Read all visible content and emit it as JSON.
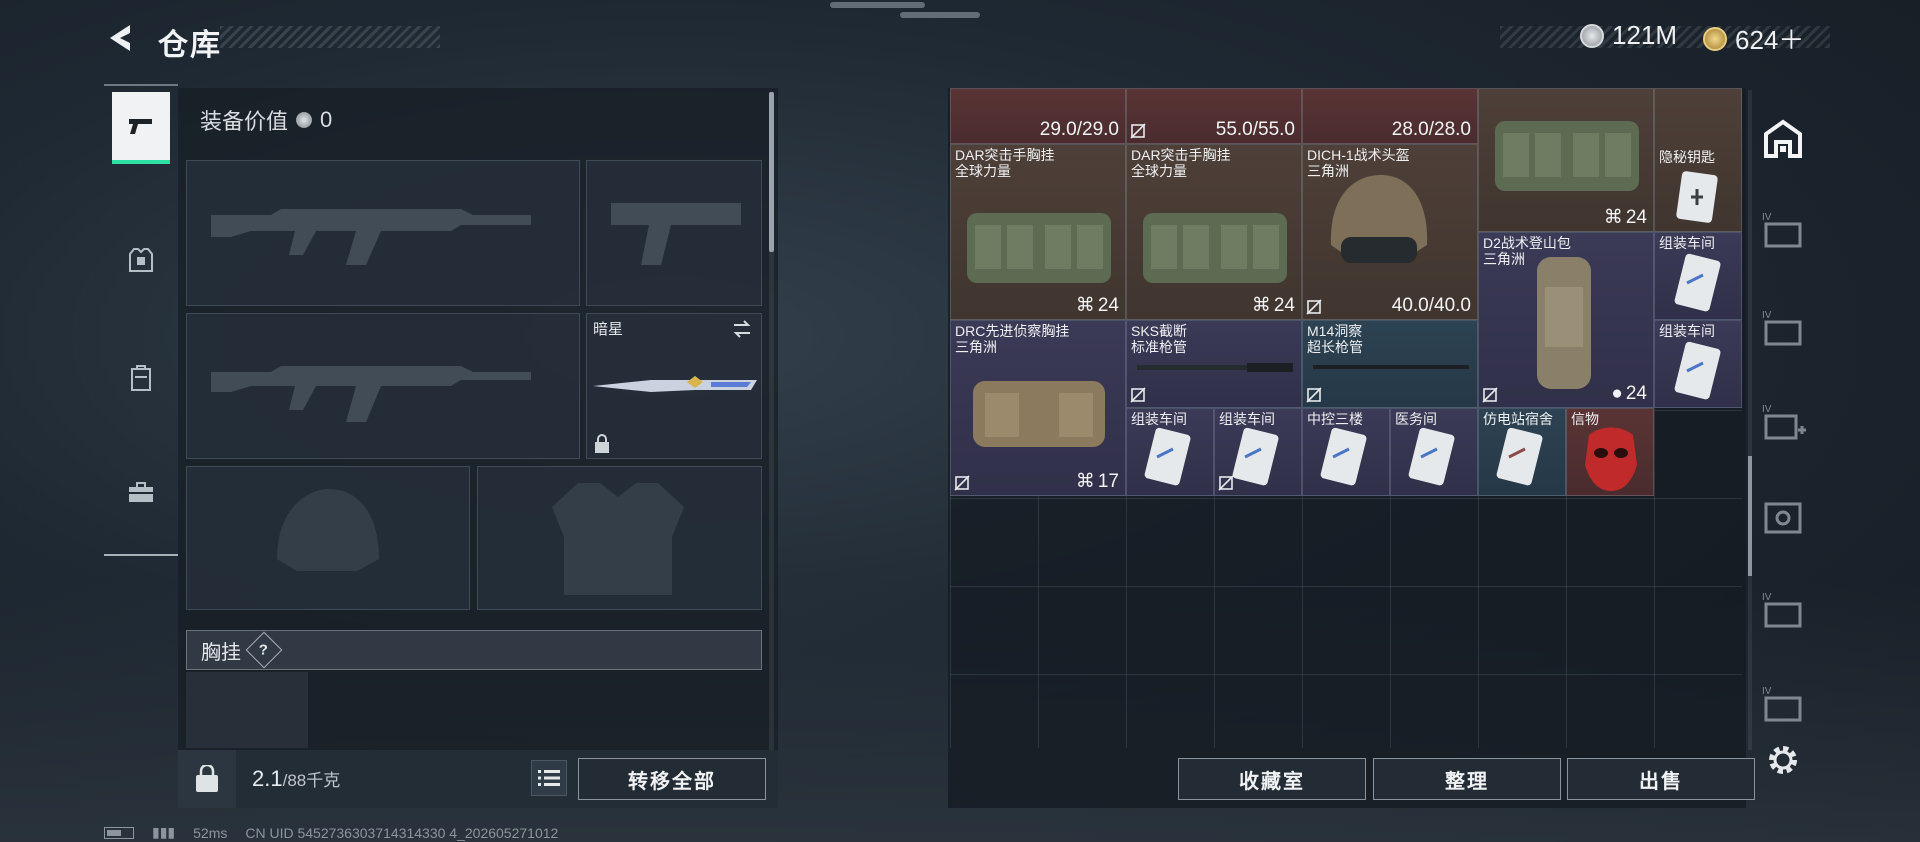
{
  "header": {
    "title": "仓库",
    "currencies": [
      {
        "icon": "silver-coin-icon",
        "amount": "121M"
      },
      {
        "icon": "gold-coin-icon",
        "amount": "624＋"
      }
    ]
  },
  "equipment": {
    "value_label": "装备价值",
    "value": "0",
    "knife_slot": {
      "skin_name": "暗星"
    },
    "chest_rig_section": {
      "label": "胸挂",
      "help": "?"
    },
    "weight_current": "2.1",
    "weight_max": "/88千克",
    "transfer_all": "转移全部"
  },
  "stash": {
    "items": [
      {
        "name": "",
        "sub": "",
        "durability": "29.0/29.0",
        "qty": ""
      },
      {
        "name": "",
        "sub": "",
        "durability": "55.0/55.0",
        "qty": ""
      },
      {
        "name": "",
        "sub": "",
        "durability": "28.0/28.0",
        "qty": ""
      },
      {
        "name": "",
        "sub": "",
        "durability": "",
        "qty": "24"
      },
      {
        "name": "隐秘钥匙",
        "sub": "",
        "durability": "",
        "qty": ""
      },
      {
        "name": "DAR突击手胸挂",
        "sub": "全球力量",
        "durability": "",
        "qty": "24"
      },
      {
        "name": "DAR突击手胸挂",
        "sub": "全球力量",
        "durability": "",
        "qty": "24"
      },
      {
        "name": "DICH-1战术头盔",
        "sub": "三角洲",
        "durability": "40.0/40.0",
        "qty": ""
      },
      {
        "name": "D2战术登山包",
        "sub": "三角洲",
        "durability": "",
        "qty": "24"
      },
      {
        "name": "组装车间",
        "sub": "",
        "durability": "",
        "qty": ""
      },
      {
        "name": "组装车间",
        "sub": "",
        "durability": "",
        "qty": ""
      },
      {
        "name": "DRC先进侦察胸挂",
        "sub": "三角洲",
        "durability": "",
        "qty": "17"
      },
      {
        "name": "SKS截断",
        "sub": "标准枪管",
        "durability": "",
        "qty": ""
      },
      {
        "name": "M14洞察",
        "sub": "超长枪管",
        "durability": "",
        "qty": ""
      },
      {
        "name": "组装车间",
        "sub": "",
        "durability": "",
        "qty": ""
      },
      {
        "name": "组装车间",
        "sub": "",
        "durability": "",
        "qty": ""
      },
      {
        "name": "中控三楼",
        "sub": "",
        "durability": "",
        "qty": ""
      },
      {
        "name": "医务间",
        "sub": "",
        "durability": "",
        "qty": ""
      },
      {
        "name": "仿电站宿舍",
        "sub": "",
        "durability": "",
        "qty": ""
      },
      {
        "name": "信物",
        "sub": "",
        "durability": "",
        "qty": ""
      }
    ],
    "buttons": {
      "collection": "收藏室",
      "organize": "整理",
      "sell": "出售"
    }
  },
  "footer": {
    "ping": "52ms",
    "uid": "CN UID 5452736303714314330 4_202605271012"
  },
  "colors": {
    "accent_green": "#2ee0a2",
    "item_red": "#5a3434",
    "item_brown": "#4e4038",
    "item_purple": "#3b3a57",
    "item_blue": "#2d4252"
  }
}
